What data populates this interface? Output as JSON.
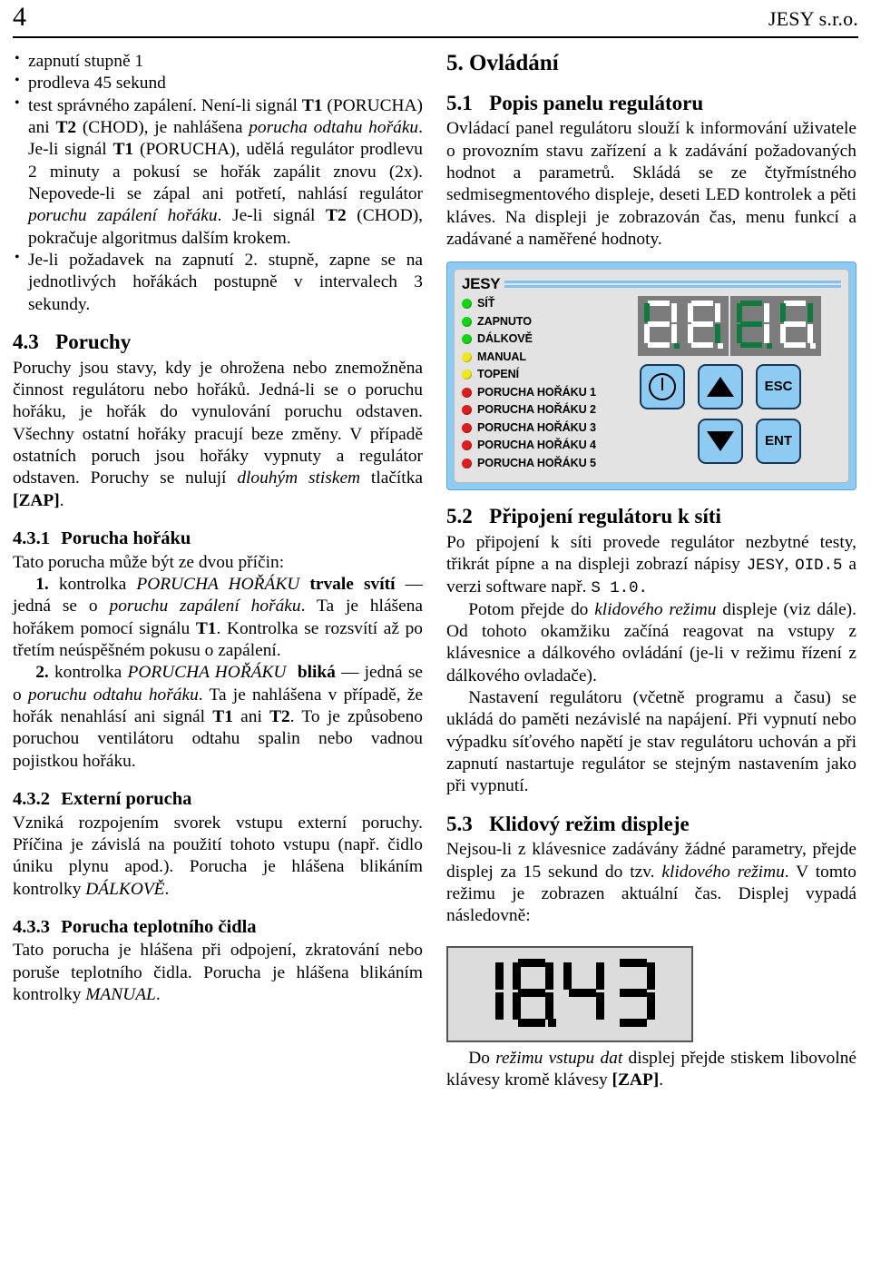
{
  "header": {
    "folio": "4",
    "company": "JESY s.r.o."
  },
  "left_column": {
    "bullets_continued": [
      "zapnutí stupně 1",
      "prodleva 45 sekund"
    ],
    "bullet_test": {
      "t1": "T1",
      "t2": "T2",
      "t1b": "T1",
      "t2b": "T2",
      "part1": "test správného zapálení. Není-li signál ",
      "part2": " (PORUCHA) ani ",
      "part3": " (CHOD), je nahlášena ",
      "italic1": "porucha odtahu hořáku",
      "part4": ". Je-li signál ",
      "part5": " (PORUCHA), udělá regulátor prodlevu 2 minuty a pokusí se hořák zapálit znovu (2x). Nepovede-li se zápal ani potřetí, nahlásí regulátor ",
      "italic2": "poruchu zapálení hořáku",
      "part6": ". Je-li signál ",
      "part7": " (CHOD), pokračuje algoritmus dalším krokem."
    },
    "bullet_stage2": "Je-li požadavek na zapnutí 2. stupně, zapne se na jednotlivých hořákách postupně v intervalech 3 sekundy.",
    "sec43": {
      "number": "4.3",
      "title": "Poruchy",
      "para_a": "Poruchy jsou stavy, kdy je ohrožena nebo znemožněna činnost regulátoru nebo hořáků. Jedná-li se o poruchu hořáku, je hořák do vynulování poruchu odstaven. Všechny ostatní hořáky pracují beze změny. V případě ostatních poruch jsou hořáky vypnuty a regulátor odstaven. Poruchy se nulují ",
      "para_a_italic": "dlouhým stiskem",
      "para_a_end": " tlačítka ",
      "para_a_bold": "[ZAP]",
      "para_a_dot": "."
    },
    "sec431": {
      "number": "4.3.1",
      "title": "Porucha hořáku",
      "intro": "Tato porucha může být  ze dvou příčin:",
      "item1": {
        "num": "1.",
        "t1": " kontrolka ",
        "italic_led": "PORUCHA HOŘÁKU",
        "bold_state": "trvale svítí",
        "dash": " — jedná se o ",
        "italic_fault": "poruchu zapálení hořáku",
        "rest1": ". Ta je hlášena hořákem pomocí signálu ",
        "sig": "T1",
        "rest2": ". Kontrolka se rozsvítí až po třetím neúspěšném pokusu o zapálení."
      },
      "item2": {
        "num": "2.",
        "t1": " kontrolka ",
        "italic_led": "PORUCHA HOŘÁKU",
        "bold_state": "bliká",
        "dash": " — jedná se o ",
        "italic_fault": "poruchu odtahu hořáku",
        "rest1": ". Ta je nahlášena v případě, že hořák nenahlásí ani signál ",
        "sig1": "T1",
        "mid": " ani ",
        "sig2": "T2",
        "rest2": ". To je způsobeno poruchou ventilátoru odtahu spalin nebo vadnou pojistkou hořáku."
      }
    },
    "sec432": {
      "number": "4.3.2",
      "title": "Externí porucha",
      "para": "Vzniká rozpojením svorek vstupu externí poruchy. Příčina je závislá na použití tohoto vstupu (např. čidlo úniku plynu apod.). Porucha je hlášena blikáním kontrolky ",
      "italic_led": "DÁLKOVĚ",
      "para_end": "."
    },
    "sec433": {
      "number": "4.3.3",
      "title": "Porucha teplotního čidla",
      "para": "Tato porucha je hlášena při odpojení, zkratování nebo poruše teplotního čidla. Porucha je hlášena blikáním kontrolky ",
      "italic_led": "MANUAL",
      "para_end": "."
    }
  },
  "right_column": {
    "sec5": {
      "number": "5.",
      "title": "Ovládání"
    },
    "sec51": {
      "number": "5.1",
      "title": "Popis panelu regulátoru",
      "para": "Ovládací panel regulátoru slouží k informování uživatele o provozním stavu zařízení a k zadávání požadovaných hodnot a parametrů. Skládá se ze čtyřmístného sedmisegmentového displeje, deseti LED kontrolek a pěti kláves. Na displeji je zobrazován čas, menu funkcí a zadávané a naměřené hodnoty."
    },
    "panel_figure": {
      "brand": "JESY",
      "leds": [
        {
          "label": "SÍŤ",
          "color": "#13d613"
        },
        {
          "label": "ZAPNUTO",
          "color": "#13d613"
        },
        {
          "label": "DÁLKOVĚ",
          "color": "#13d613"
        },
        {
          "label": "MANUAL",
          "color": "#f0e81b"
        },
        {
          "label": "TOPENÍ",
          "color": "#f0e81b"
        },
        {
          "label": "PORUCHA HOŘÁKU 1",
          "color": "#e01b1b"
        },
        {
          "label": "PORUCHA HOŘÁKU 2",
          "color": "#e01b1b"
        },
        {
          "label": "PORUCHA HOŘÁKU 3",
          "color": "#e01b1b"
        },
        {
          "label": "PORUCHA HOŘÁKU 4",
          "color": "#e01b1b"
        },
        {
          "label": "PORUCHA HOŘÁKU 5",
          "color": "#e01b1b"
        }
      ],
      "display": {
        "background": "#7c7c7c",
        "segment_on_color": "#0f7a3d",
        "segment_off_color": "#ffffff",
        "digits": [
          {
            "on": [
              "f"
            ],
            "off": [
              "a",
              "b",
              "c",
              "d",
              "e",
              "g",
              "dp"
            ]
          },
          {
            "on": [
              "c"
            ],
            "off": [
              "a",
              "b",
              "d",
              "e",
              "f",
              "g",
              "dp"
            ]
          },
          {
            "on": [
              "a",
              "f",
              "g",
              "e",
              "d"
            ],
            "off": [
              "b",
              "c",
              "dp"
            ]
          },
          {
            "on": [
              "f",
              "b"
            ],
            "off": [
              "a",
              "c",
              "d",
              "e",
              "g",
              "dp"
            ]
          }
        ]
      },
      "keys": [
        {
          "name": "power-key",
          "label": "",
          "glyph": "power"
        },
        {
          "name": "up-key",
          "label": "",
          "glyph": "triangle-up"
        },
        {
          "name": "esc-key",
          "label": "ESC",
          "glyph": "text"
        },
        {
          "name": "down-key",
          "label": "",
          "glyph": "triangle-down"
        },
        {
          "name": "ent-key",
          "label": "ENT",
          "glyph": "text"
        }
      ],
      "panel_frame_color": "#8ecbf2",
      "panel_face_color": "#e3e3e3",
      "key_color": "#8ecbf2"
    },
    "sec52": {
      "number": "5.2",
      "title": "Připojení regulátoru k síti",
      "para_a1": "Po připojení k síti provede regulátor nezbytné testy, třikrát pípne a na displeji zobrazí nápisy ",
      "mono1": "JESY",
      "para_a2": ", ",
      "mono2": "OID.5",
      "para_a3": " a verzi software např. ",
      "mono3": "S 1.0.",
      "para_b1": "Potom přejde do ",
      "para_b_italic": "klidového režimu",
      "para_b2": " displeje (viz dále). Od tohoto okamžiku začíná reagovat na vstupy z klávesnice a dálkového ovládání (je-li v režimu řízení z dálkového ovladače).",
      "para_c": "Nastavení regulátoru (včetně programu a času) se ukládá do paměti nezávislé na napájení. Při vypnutí nebo výpadku síťového napětí je stav regulátoru uchován a při zapnutí nastartuje regulátor se stejným nastavením jako při vypnutí."
    },
    "sec53": {
      "number": "5.3",
      "title": "Klidový režim displeje",
      "para_a1": "Nejsou-li z klávesnice zadávány žádné parametry, přejde displej za 15 sekund do tzv. ",
      "para_a_italic": "klidového režimu",
      "para_a2": ". V tomto režimu je zobrazen aktuální čas. Displej vypadá následovně:",
      "clock_figure": {
        "value": "18.43",
        "background": "#dcdcdc",
        "segment_color": "#000000",
        "digits": [
          {
            "char": "1",
            "on": [
              "b",
              "c"
            ]
          },
          {
            "char": "8",
            "on": [
              "a",
              "b",
              "c",
              "d",
              "e",
              "f",
              "g",
              "dp"
            ]
          },
          {
            "char": "4",
            "on": [
              "b",
              "c",
              "f",
              "g"
            ]
          },
          {
            "char": "3",
            "on": [
              "a",
              "b",
              "c",
              "d",
              "g"
            ]
          }
        ]
      },
      "para_b1": "Do ",
      "para_b_italic": "režimu vstupu dat",
      "para_b2": " displej přejde stiskem libovolné klávesy kromě klávesy ",
      "para_b_bold": "[ZAP]",
      "para_b3": "."
    }
  }
}
